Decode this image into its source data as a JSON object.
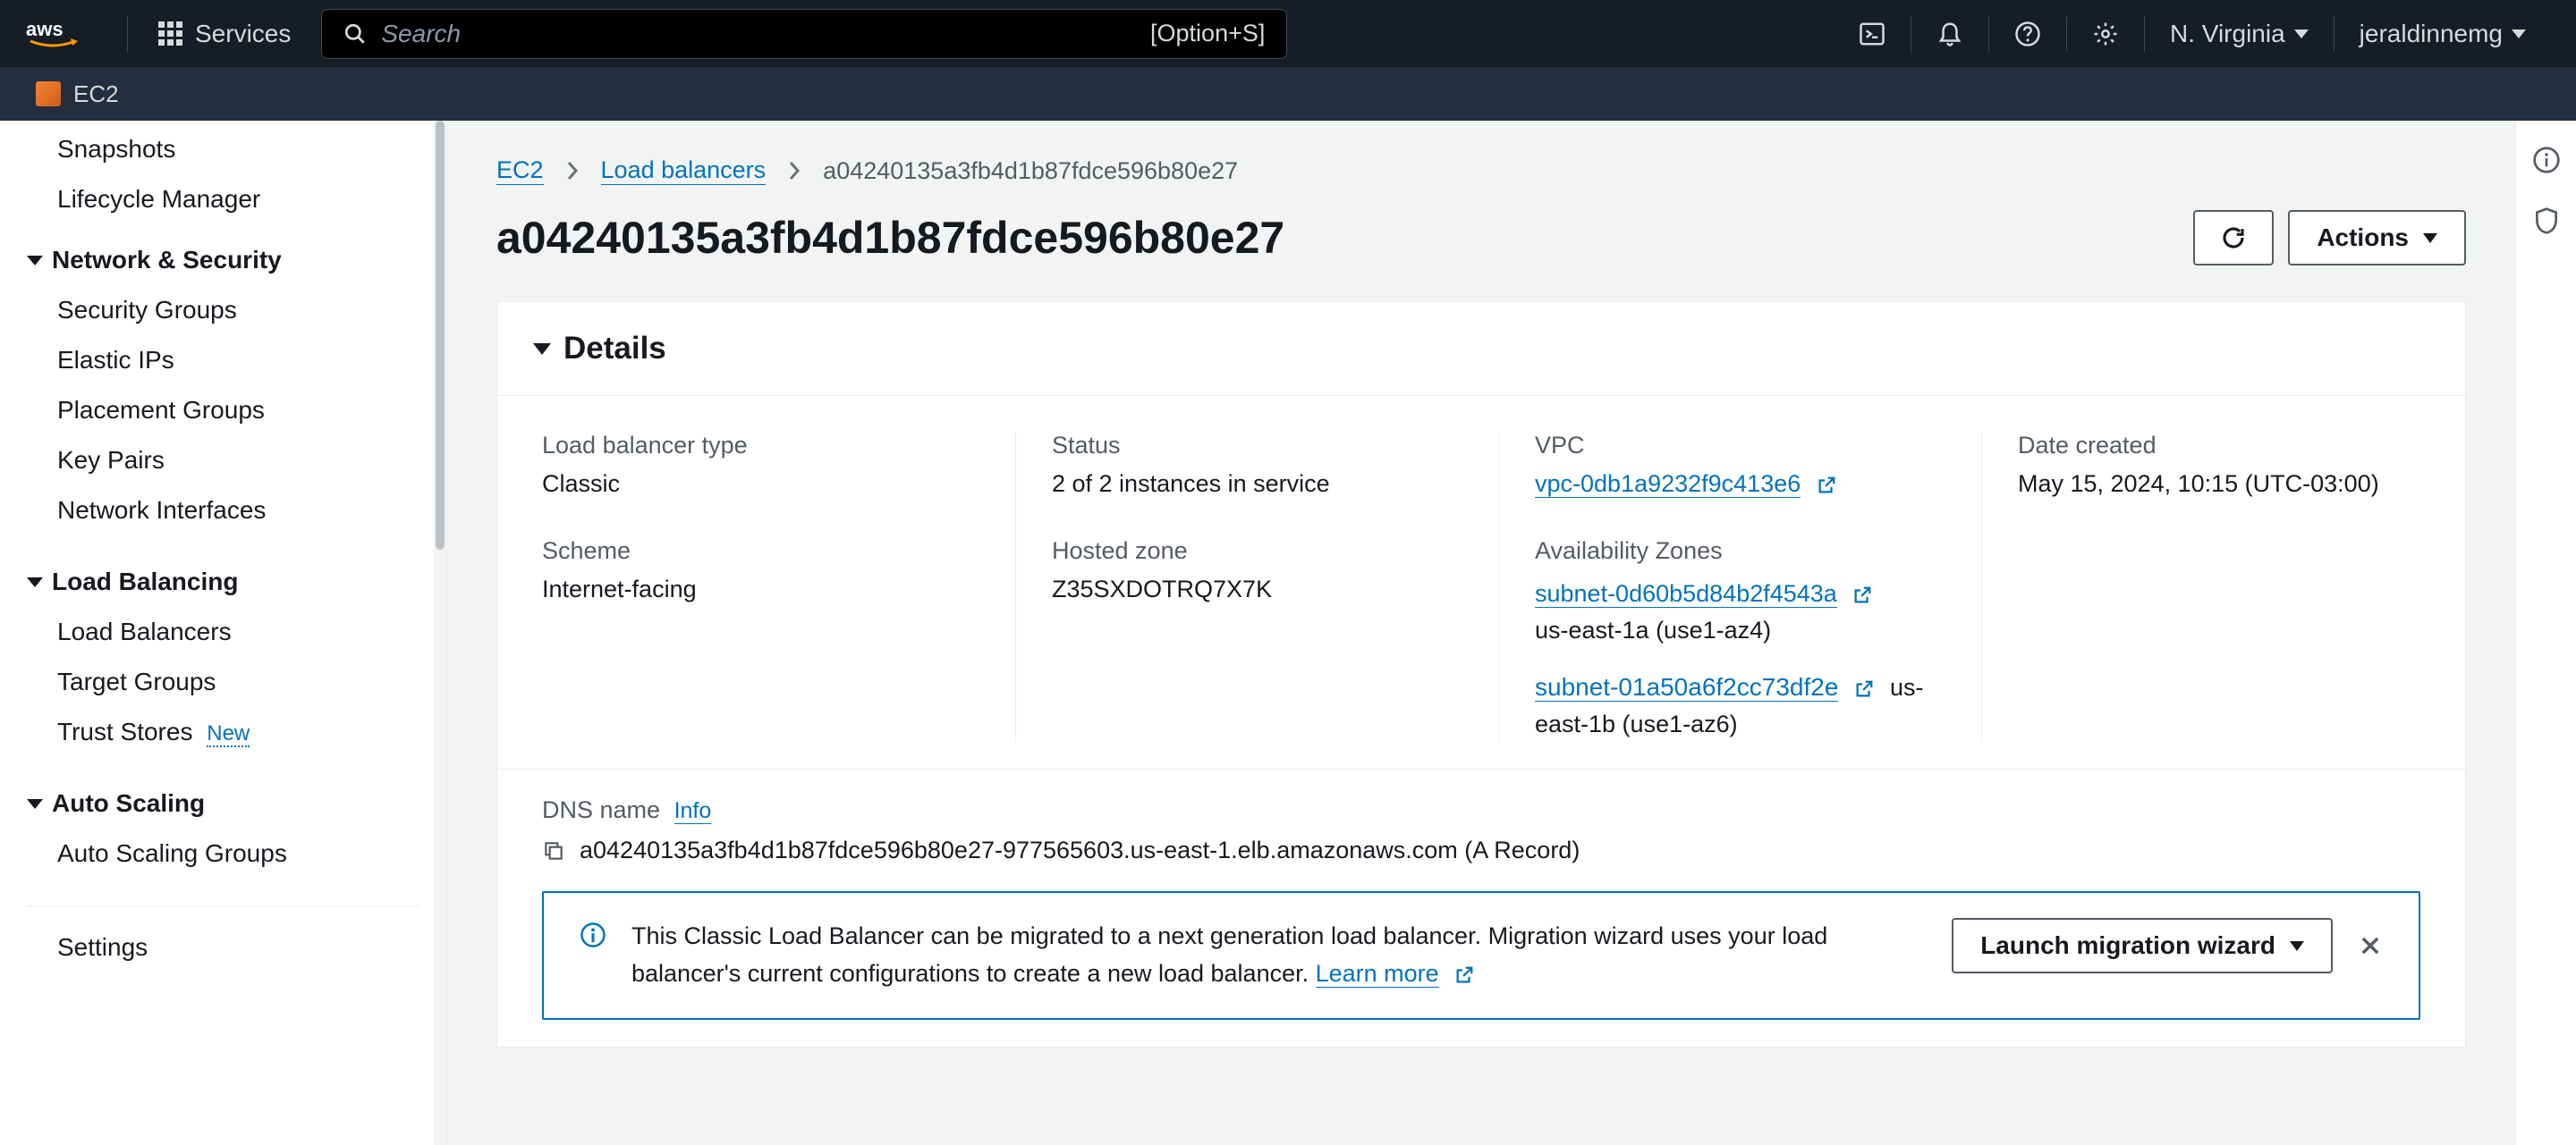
{
  "header": {
    "services_label": "Services",
    "search_placeholder": "Search",
    "search_shortcut": "[Option+S]",
    "region": "N. Virginia",
    "user": "jeraldinnemg"
  },
  "service_bar": {
    "name": "EC2"
  },
  "sidebar": {
    "orphan_items": [
      "Snapshots",
      "Lifecycle Manager"
    ],
    "groups": [
      {
        "title": "Network & Security",
        "items": [
          "Security Groups",
          "Elastic IPs",
          "Placement Groups",
          "Key Pairs",
          "Network Interfaces"
        ]
      },
      {
        "title": "Load Balancing",
        "items": [
          "Load Balancers",
          "Target Groups",
          "Trust Stores"
        ],
        "new_on": [
          "Trust Stores"
        ]
      },
      {
        "title": "Auto Scaling",
        "items": [
          "Auto Scaling Groups"
        ]
      }
    ],
    "settings_label": "Settings",
    "new_badge": "New"
  },
  "breadcrumb": {
    "ec2": "EC2",
    "lb": "Load balancers",
    "current": "a04240135a3fb4d1b87fdce596b80e27"
  },
  "title": "a04240135a3fb4d1b87fdce596b80e27",
  "actions_button": "Actions",
  "details": {
    "heading": "Details",
    "fields": {
      "lb_type_label": "Load balancer type",
      "lb_type_value": "Classic",
      "status_label": "Status",
      "status_value": "2 of 2 instances in service",
      "vpc_label": "VPC",
      "vpc_value": "vpc-0db1a9232f9c413e6",
      "date_label": "Date created",
      "date_value": "May 15, 2024, 10:15 (UTC-03:00)",
      "scheme_label": "Scheme",
      "scheme_value": "Internet-facing",
      "hosted_zone_label": "Hosted zone",
      "hosted_zone_value": "Z35SXDOTRQ7X7K",
      "azs_label": "Availability Zones",
      "az1_subnet": "subnet-0d60b5d84b2f4543a",
      "az1_zone": "us-east-1a (use1-az4)",
      "az2_subnet": "subnet-01a50a6f2cc73df2e",
      "az2_zone": "us-east-1b (use1-az6)"
    },
    "dns": {
      "label": "DNS name",
      "info": "Info",
      "value": "a04240135a3fb4d1b87fdce596b80e27-977565603.us-east-1.elb.amazonaws.com (A Record)"
    },
    "info_box": {
      "text_a": "This Classic Load Balancer can be migrated to a next generation load balancer. Migration wizard uses your load balancer's current configurations to create a new load balancer. ",
      "learn_more": "Learn more",
      "wizard_btn": "Launch migration wizard"
    }
  }
}
